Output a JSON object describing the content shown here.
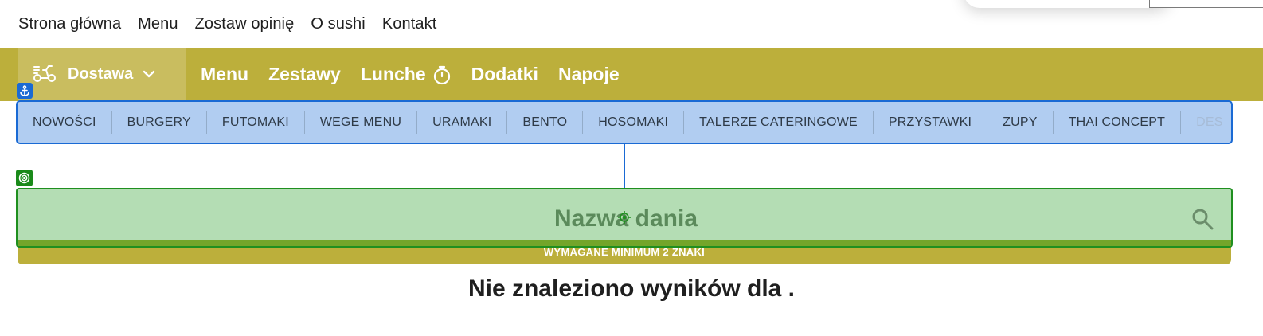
{
  "top_nav": {
    "items": [
      "Strona główna",
      "Menu",
      "Zostaw opinię",
      "O sushi",
      "Kontakt"
    ]
  },
  "main_nav": {
    "delivery_label": "Dostawa",
    "links": [
      "Menu",
      "Zestawy",
      "Lunche",
      "Dodatki",
      "Napoje"
    ]
  },
  "categories": [
    "NOWOŚCI",
    "BURGERY",
    "FUTOMAKI",
    "WEGE MENU",
    "URAMAKI",
    "BENTO",
    "HOSOMAKI",
    "TALERZE CATERINGOWE",
    "PRZYSTAWKI",
    "ZUPY",
    "THAI CONCEPT",
    "DES"
  ],
  "search": {
    "placeholder": "Nazwa dania",
    "hint": "WYMAGANE MINIMUM 2 ZNAKI"
  },
  "results": {
    "message": "Nie znaleziono wyników dla ."
  },
  "colors": {
    "brand_olive": "#bcaf3b",
    "highlight_blue": "#1a6ad4",
    "highlight_green": "#1f8f1f"
  }
}
